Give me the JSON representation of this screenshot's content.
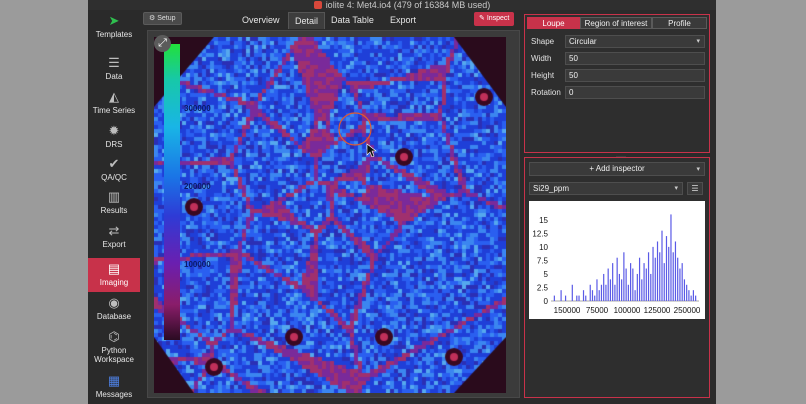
{
  "window": {
    "title": "iolite 4: Met4.io4 (479 of 16384 MB used)"
  },
  "sidebar": {
    "items": [
      {
        "label": "Templates",
        "icon": "send-icon",
        "glyph": "➤",
        "active": false
      },
      {
        "label": "Data",
        "icon": "database-icon",
        "glyph": "☰",
        "active": false
      },
      {
        "label": "Time Series",
        "icon": "area-chart-icon",
        "glyph": "◭",
        "active": false
      },
      {
        "label": "DRS",
        "icon": "gear-icon",
        "glyph": "✹",
        "active": false
      },
      {
        "label": "QA/QC",
        "icon": "thumbs-up-icon",
        "glyph": "✔",
        "active": false
      },
      {
        "label": "Results",
        "icon": "bar-chart-icon",
        "glyph": "▥",
        "active": false
      },
      {
        "label": "Export",
        "icon": "arrows-icon",
        "glyph": "⇄",
        "active": false
      },
      {
        "label": "Imaging",
        "icon": "map-icon",
        "glyph": "▤",
        "active": true
      },
      {
        "label": "Database",
        "icon": "globe-icon",
        "glyph": "◉",
        "active": false
      },
      {
        "label": "Python Workspace",
        "icon": "python-icon",
        "glyph": "⌬",
        "active": false
      },
      {
        "label": "Messages",
        "icon": "calendar-badge-icon",
        "glyph": "▦",
        "active": false
      }
    ]
  },
  "toolbar": {
    "setup_label": "Setup",
    "tabs": [
      "Overview",
      "Detail",
      "Data Table",
      "Export"
    ],
    "selected_tab": "Detail",
    "inspect_label": "Inspect"
  },
  "image": {
    "colorbar_labels": [
      "300000",
      "200000",
      "100000"
    ],
    "fit_icon": "expand-icon"
  },
  "inspector": {
    "tabs": [
      "Loupe",
      "Region of interest",
      "Profile"
    ],
    "selected_tab": "Loupe",
    "fields": {
      "shape_label": "Shape",
      "shape_value": "Circular",
      "width_label": "Width",
      "width_value": "50",
      "height_label": "Height",
      "height_value": "50",
      "rotation_label": "Rotation",
      "rotation_value": "0"
    },
    "add_inspector_label": "+ Add inspector",
    "channel": "Si29_ppm"
  },
  "colors": {
    "accent": "#c8324a",
    "bar": "#5a5ae6"
  },
  "chart_data": {
    "type": "bar",
    "title": "",
    "xlabel": "",
    "ylabel": "",
    "y_ticks": [
      "15",
      "12.5",
      "10",
      "7.5",
      "5",
      "2.5",
      "0"
    ],
    "ylim": [
      0,
      17
    ],
    "x_ticks": [
      "150000",
      "75000",
      "100000",
      "125000",
      "250000"
    ],
    "values": [
      0,
      1,
      0,
      0,
      2,
      0,
      1,
      0,
      0,
      3,
      0,
      1,
      1,
      0,
      2,
      1,
      0,
      3,
      2,
      1,
      4,
      2,
      3,
      5,
      3,
      6,
      4,
      7,
      3,
      8,
      5,
      4,
      9,
      6,
      3,
      7,
      6,
      2,
      5,
      8,
      4,
      7,
      6,
      9,
      5,
      10,
      8,
      11,
      9,
      13,
      7,
      12,
      10,
      16,
      9,
      11,
      8,
      6,
      7,
      4,
      3,
      2,
      1,
      2,
      1,
      0
    ]
  }
}
